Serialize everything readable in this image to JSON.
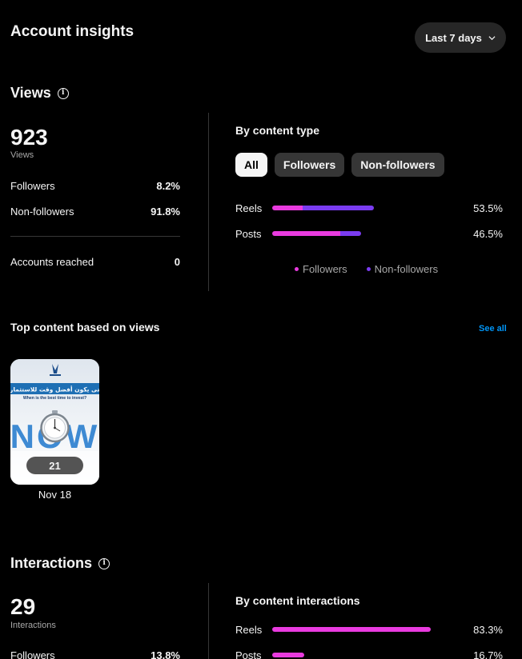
{
  "header": {
    "title": "Account insights",
    "range_label": "Last 7 days"
  },
  "colors": {
    "followers": "#e93bdf",
    "non_followers": "#7a3cf0",
    "link": "#0095f6"
  },
  "views": {
    "title": "Views",
    "total": "923",
    "total_label": "Views",
    "followers_label": "Followers",
    "followers_value": "8.2%",
    "non_followers_label": "Non-followers",
    "non_followers_value": "91.8%",
    "reached_label": "Accounts reached",
    "reached_value": "0",
    "by_type_title": "By content type",
    "filters": [
      "All",
      "Followers",
      "Non-followers"
    ],
    "active_filter": "All",
    "bars": [
      {
        "label": "Reels",
        "pct_text": "53.5%",
        "share": 53.5,
        "followers_part": 0.3
      },
      {
        "label": "Posts",
        "pct_text": "46.5%",
        "share": 46.5,
        "followers_part": 0.77
      }
    ],
    "legend": [
      "Followers",
      "Non-followers"
    ]
  },
  "top_content": {
    "title": "Top content based on views",
    "see_all": "See all",
    "items": [
      {
        "date": "Nov 18",
        "count": "21",
        "caption_ar": "متى يكون أفضل وقت للاستثمار؟",
        "caption_en": "When is the best time to invest?",
        "big_word": "NOW"
      }
    ]
  },
  "interactions": {
    "title": "Interactions",
    "total": "29",
    "total_label": "Interactions",
    "followers_label": "Followers",
    "followers_value": "13.8%",
    "by_type_title": "By content interactions",
    "bars": [
      {
        "label": "Reels",
        "pct_text": "83.3%",
        "share": 83.3
      },
      {
        "label": "Posts",
        "pct_text": "16.7%",
        "share": 16.7
      }
    ]
  }
}
